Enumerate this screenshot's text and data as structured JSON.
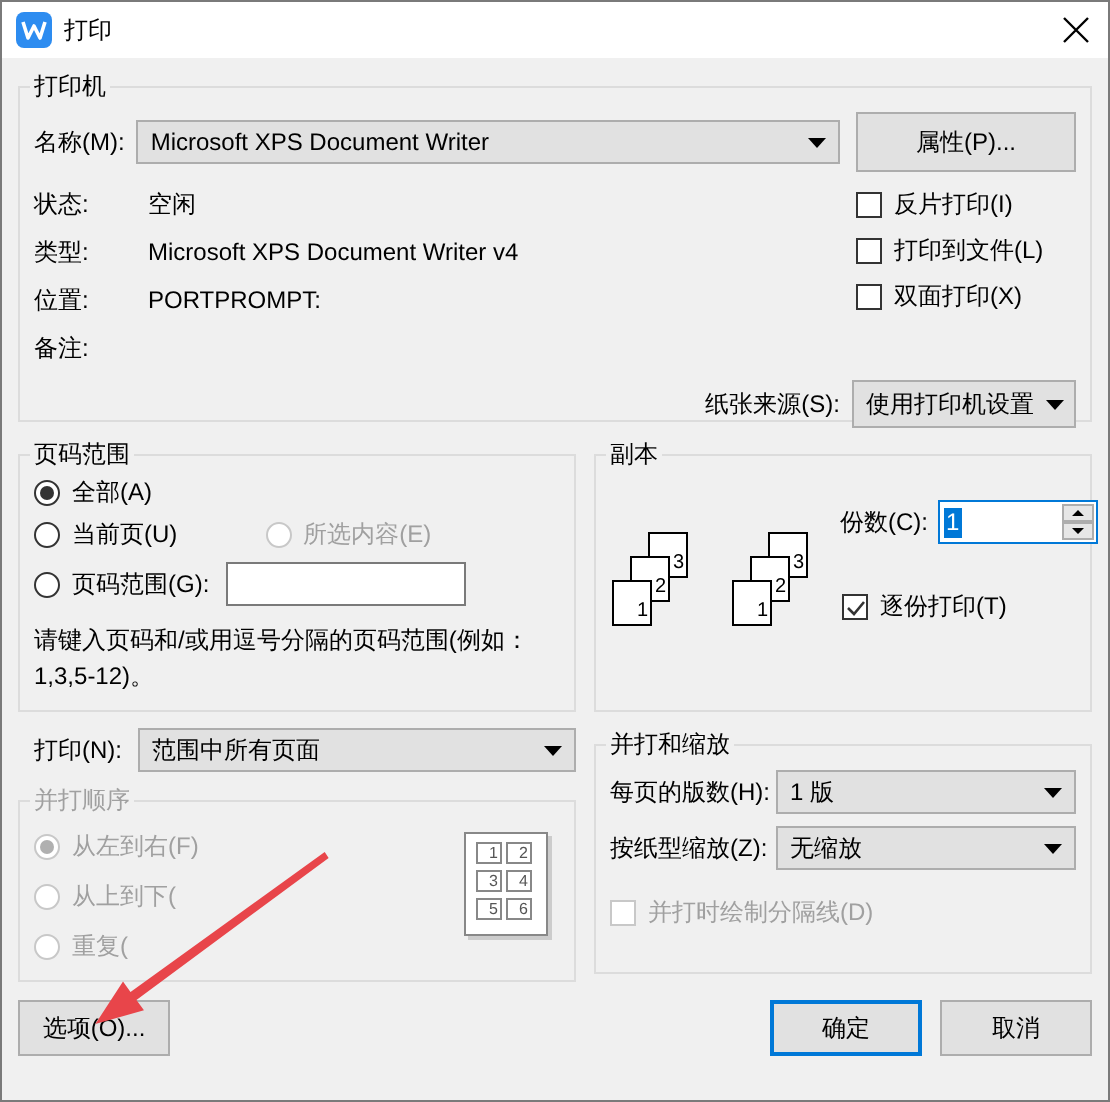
{
  "window": {
    "title": "打印"
  },
  "printer": {
    "title": "打印机",
    "name_label": "名称(M):",
    "name_value": "Microsoft XPS Document Writer",
    "properties_button": "属性(P)...",
    "info": [
      {
        "label": "状态:",
        "value": "空闲"
      },
      {
        "label": "类型:",
        "value": "Microsoft XPS Document Writer v4"
      },
      {
        "label": "位置:",
        "value": "PORTPROMPT:"
      },
      {
        "label": "备注:"
      }
    ],
    "options": [
      {
        "label": "反片打印(I)",
        "checked": false
      },
      {
        "label": "打印到文件(L)",
        "checked": false
      },
      {
        "label": "双面打印(X)",
        "checked": false
      }
    ],
    "paper_source": {
      "label": "纸张来源(S):",
      "value": "使用打印机设置"
    }
  },
  "page_range": {
    "title": "页码范围",
    "rows": [
      [
        {
          "kind": "radio",
          "label": "全部(A)",
          "selected": true,
          "disabled": false
        }
      ],
      [
        {
          "kind": "radio",
          "label": "当前页(U)",
          "selected": false,
          "disabled": false
        },
        {
          "kind": "radio",
          "label": "所选内容(E)",
          "selected": false,
          "disabled": true
        }
      ],
      [
        {
          "kind": "radio_field",
          "label": "页码范围(G):",
          "selected": false,
          "disabled": false
        }
      ]
    ],
    "hint": "请键入页码和/或用逗号分隔的页码范围(例如：1,3,5-12)。"
  },
  "copies": {
    "title": "副本",
    "stacks": [
      {
        "pages": [
          "3",
          "2",
          "1"
        ]
      },
      {
        "pages": [
          "3",
          "2",
          "1"
        ]
      }
    ],
    "count_label": "份数(C):",
    "count_value": "1",
    "collate": {
      "label": "逐份打印(T)",
      "checked": true
    }
  },
  "print_what": {
    "label": "打印(N):",
    "value": "范围中所有页面"
  },
  "order": {
    "title": "并打顺序",
    "disabled": true,
    "options": [
      {
        "label": "从左到右(F)",
        "selected": true
      },
      {
        "label": "从上到下(",
        "selected": false
      },
      {
        "label": "重复(",
        "selected": false
      }
    ],
    "preview": [
      "1",
      "2",
      "3",
      "4",
      "5",
      "6"
    ]
  },
  "scaling": {
    "title": "并打和缩放",
    "rows": [
      {
        "label": "每页的版数(H):",
        "value": "1 版"
      },
      {
        "label": "按纸型缩放(Z):",
        "value": "无缩放"
      }
    ],
    "separator": {
      "label": "并打时绘制分隔线(D)",
      "checked": false,
      "disabled": true
    }
  },
  "buttons": [
    {
      "label": "选项(O)...",
      "default": false
    },
    {
      "label": "确定",
      "default": true
    },
    {
      "label": "取消",
      "default": false
    }
  ]
}
